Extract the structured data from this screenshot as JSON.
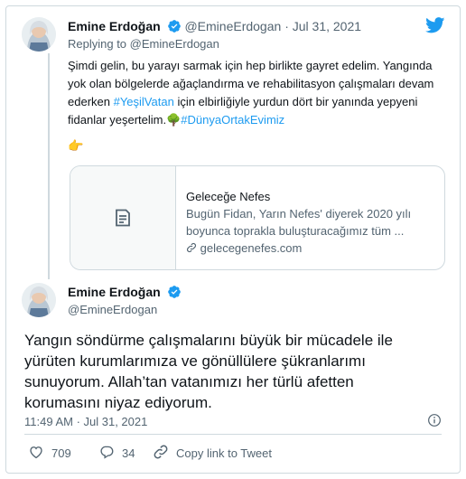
{
  "reply_tweet": {
    "author_name": "Emine Erdoğan",
    "handle": "@EmineErdogan",
    "separator": "·",
    "date": "Jul 31, 2021",
    "replying_prefix": "Replying to",
    "replying_handle": "@EmineErdogan",
    "text_line1": "Şimdi gelin, bu yarayı sarmak için hep birlikte gayret edelim. Yangında",
    "text_line2": "yok olan bölgelerde ağaçlandırma ve rehabilitasyon çalışmaları devam",
    "text_line3_prefix": "ederken ",
    "hashtag1": "#YeşilVatan",
    "text_line3_suffix": " için elbirliğiyle yurdun dört bir yanında yepyeni",
    "text_line4_prefix": "fidanlar yeşertelim.",
    "tree_emoji": "🌳",
    "hashtag2": "#DünyaOrtakEvimiz",
    "pointing_emoji": "👉",
    "link_card": {
      "title": "Geleceğe Nefes",
      "description": "Bugün Fidan, Yarın Nefes' diyerek 2020 yılı",
      "description_line2": "boyunca toprakla buluşturacağımız tüm ...",
      "domain": "gelecegenefes.com",
      "thumb_icon": "document-icon"
    }
  },
  "main_tweet": {
    "author_name": "Emine Erdoğan",
    "handle": "@EmineErdogan",
    "text_line1": "Yangın söndürme çalışmalarını büyük bir mücadele ile",
    "text_line2": "yürüten kurumlarımıza ve gönüllülere şükranlarımı",
    "text_line3": "sunuyorum. Allah’tan vatanımızı her türlü afetten",
    "text_line4": "korumasını niyaz ediyorum.",
    "time": "11:49 AM · Jul 31, 2021",
    "like_count": "709",
    "reply_count": "34",
    "copy_link_label": "Copy link to Tweet"
  },
  "colors": {
    "accent": "#1d9bf0",
    "text": "#0f1419",
    "muted": "#536471",
    "border": "#cfd9de"
  },
  "icons": [
    "twitter-bird-icon",
    "verified-badge-icon",
    "info-icon",
    "heart-icon",
    "reply-icon",
    "copy-link-icon",
    "chain-link-icon",
    "document-icon"
  ]
}
